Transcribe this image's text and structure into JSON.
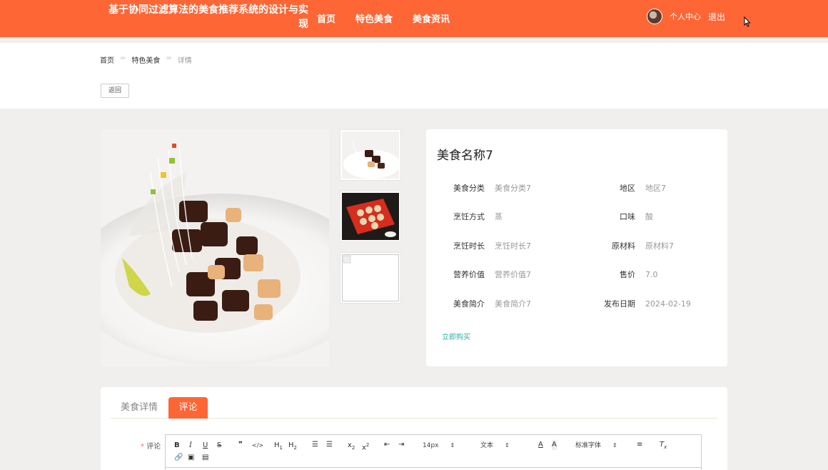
{
  "header": {
    "title": "基于协同过滤算法的美食推荐系统的设计与实现",
    "nav": [
      "首页",
      "特色美食",
      "美食资讯"
    ],
    "user_center": "个人中心",
    "logout": "退出"
  },
  "breadcrumb": [
    "首页",
    "特色美食",
    "详情"
  ],
  "breadcrumb_sep": "=",
  "back_label": "返回",
  "food": {
    "name": "美食名称7",
    "fields": [
      {
        "label": "美食分类",
        "value": "美食分类7"
      },
      {
        "label": "地区",
        "value": "地区7"
      },
      {
        "label": "烹饪方式",
        "value": "蒸"
      },
      {
        "label": "口味",
        "value": "酸"
      },
      {
        "label": "烹饪时长",
        "value": "烹饪时长7"
      },
      {
        "label": "原材料",
        "value": "原材料7"
      },
      {
        "label": "营养价值",
        "value": "营养价值7"
      },
      {
        "label": "售价",
        "value": "7.0"
      },
      {
        "label": "美食简介",
        "value": "美食简介7"
      },
      {
        "label": "发布日期",
        "value": "2024-02-19"
      }
    ],
    "buy_label": "立即购买"
  },
  "tabs": [
    "美食详情",
    "评论"
  ],
  "comment": {
    "label": "评论",
    "required_mark": "*"
  },
  "editor": {
    "font_size": "14px",
    "text_type": "文本",
    "font_family": "标准字体"
  },
  "colors": {
    "accent": "#fe6636",
    "link": "#2bb0a5"
  }
}
